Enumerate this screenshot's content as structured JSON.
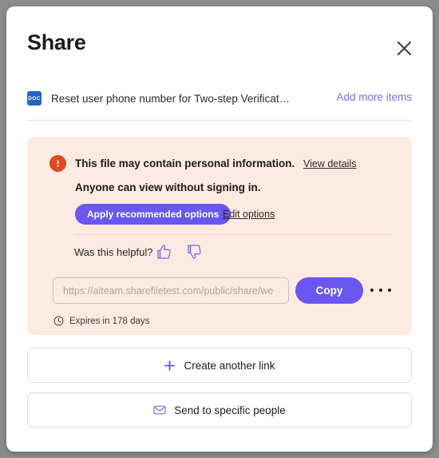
{
  "modal": {
    "title": "Share",
    "close_icon": "close-icon"
  },
  "item": {
    "file_type_badge": "DOC",
    "name": "Reset user phone number for Two-step Verificat…",
    "add_more_label": "Add more items"
  },
  "warning": {
    "icon": "alert-exclamation-icon",
    "line1": "This file may contain personal information.",
    "view_details_label": "View details",
    "line2": "Anyone can view without signing in.",
    "apply_label": "Apply recommended options",
    "edit_options_label": "Edit options",
    "helpful_label": "Was this helpful?",
    "thumb_up_icon": "thumbs-up-icon",
    "thumb_down_icon": "thumbs-down-icon"
  },
  "link": {
    "url_value": "https://aiteam.sharefiletest.com/public/share/we",
    "url_placeholder": "https://aiteam.sharefiletest.com/public/share/we",
    "copy_label": "Copy",
    "more_icon": "more-options-icon",
    "expires_icon": "clock-icon",
    "expires_text": "Expires in 178 days"
  },
  "actions": {
    "create_link_label": "Create another link",
    "create_link_icon": "plus-icon",
    "send_people_label": "Send to specific people",
    "send_people_icon": "envelope-icon"
  },
  "colors": {
    "accent_purple": "#6a56f0",
    "link_purple": "#7b6cf0",
    "warning_bg": "#fdeae0",
    "warning_icon": "#e0491d",
    "doc_badge_blue": "#2264c4"
  }
}
